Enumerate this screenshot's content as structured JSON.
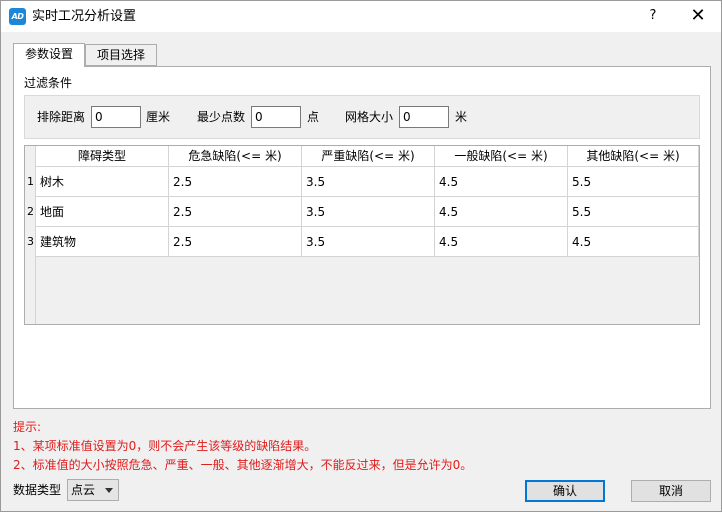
{
  "window": {
    "icon_text": "AD",
    "title": "实时工况分析设置",
    "help_label": "?",
    "close_label": "✕"
  },
  "tabs": [
    {
      "label": "参数设置",
      "active": true
    },
    {
      "label": "项目选择",
      "active": false
    }
  ],
  "filter": {
    "section_title": "过滤条件",
    "exclude_distance": {
      "label": "排除距离",
      "value": "0",
      "unit": "厘米"
    },
    "min_points": {
      "label": "最少点数",
      "value": "0",
      "unit": "点"
    },
    "grid_size": {
      "label": "网格大小",
      "value": "0",
      "unit": "米"
    }
  },
  "table": {
    "headers": [
      "障碍类型",
      "危急缺陷(<= 米)",
      "严重缺陷(<= 米)",
      "一般缺陷(<= 米)",
      "其他缺陷(<= 米)"
    ],
    "rows": [
      {
        "num": "1",
        "cells": [
          "树木",
          "2.5",
          "3.5",
          "4.5",
          "5.5"
        ]
      },
      {
        "num": "2",
        "cells": [
          "地面",
          "2.5",
          "3.5",
          "4.5",
          "5.5"
        ]
      },
      {
        "num": "3",
        "cells": [
          "建筑物",
          "2.5",
          "3.5",
          "4.5",
          "4.5"
        ]
      }
    ]
  },
  "hints": {
    "title": "提示:",
    "line1": "1、某项标准值设置为0，则不会产生该等级的缺陷结果。",
    "line2": "2、标准值的大小按照危急、严重、一般、其他逐渐增大，不能反过来，但是允许为0。",
    "color": "#e01b1b"
  },
  "footer": {
    "data_type_label": "数据类型",
    "data_type_value": "点云",
    "confirm_label": "确认",
    "cancel_label": "取消"
  },
  "colors": {
    "accent": "#0078d7",
    "icon_bg": "#1d86d6"
  }
}
